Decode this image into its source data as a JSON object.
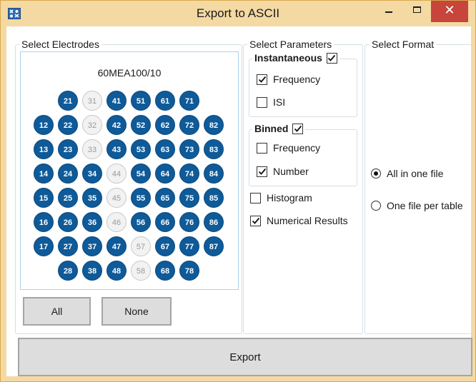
{
  "window": {
    "title": "Export to ASCII",
    "app_icon": "app-logo-icon",
    "minimize_glyph": "–",
    "close_glyph": "✕"
  },
  "electrodes": {
    "group_label": "Select Electrodes",
    "layout_name": "60MEA100/10",
    "grid": [
      [
        {
          "id": "21",
          "on": true
        },
        {
          "id": "31",
          "on": false
        },
        {
          "id": "41",
          "on": true
        },
        {
          "id": "51",
          "on": true
        },
        {
          "id": "61",
          "on": true
        },
        {
          "id": "71",
          "on": true
        }
      ],
      [
        {
          "id": "12",
          "on": true
        },
        {
          "id": "22",
          "on": true
        },
        {
          "id": "32",
          "on": false
        },
        {
          "id": "42",
          "on": true
        },
        {
          "id": "52",
          "on": true
        },
        {
          "id": "62",
          "on": true
        },
        {
          "id": "72",
          "on": true
        },
        {
          "id": "82",
          "on": true
        }
      ],
      [
        {
          "id": "13",
          "on": true
        },
        {
          "id": "23",
          "on": true
        },
        {
          "id": "33",
          "on": false
        },
        {
          "id": "43",
          "on": true
        },
        {
          "id": "53",
          "on": true
        },
        {
          "id": "63",
          "on": true
        },
        {
          "id": "73",
          "on": true
        },
        {
          "id": "83",
          "on": true
        }
      ],
      [
        {
          "id": "14",
          "on": true
        },
        {
          "id": "24",
          "on": true
        },
        {
          "id": "34",
          "on": true
        },
        {
          "id": "44",
          "on": false
        },
        {
          "id": "54",
          "on": true
        },
        {
          "id": "64",
          "on": true
        },
        {
          "id": "74",
          "on": true
        },
        {
          "id": "84",
          "on": true
        }
      ],
      [
        {
          "id": "15",
          "on": true
        },
        {
          "id": "25",
          "on": true
        },
        {
          "id": "35",
          "on": true
        },
        {
          "id": "45",
          "on": false
        },
        {
          "id": "55",
          "on": true
        },
        {
          "id": "65",
          "on": true
        },
        {
          "id": "75",
          "on": true
        },
        {
          "id": "85",
          "on": true
        }
      ],
      [
        {
          "id": "16",
          "on": true
        },
        {
          "id": "26",
          "on": true
        },
        {
          "id": "36",
          "on": true
        },
        {
          "id": "46",
          "on": false
        },
        {
          "id": "56",
          "on": true
        },
        {
          "id": "66",
          "on": true
        },
        {
          "id": "76",
          "on": true
        },
        {
          "id": "86",
          "on": true
        }
      ],
      [
        {
          "id": "17",
          "on": true
        },
        {
          "id": "27",
          "on": true
        },
        {
          "id": "37",
          "on": true
        },
        {
          "id": "47",
          "on": true
        },
        {
          "id": "57",
          "on": false
        },
        {
          "id": "67",
          "on": true
        },
        {
          "id": "77",
          "on": true
        },
        {
          "id": "87",
          "on": true
        }
      ],
      [
        {
          "id": "28",
          "on": true
        },
        {
          "id": "38",
          "on": true
        },
        {
          "id": "48",
          "on": true
        },
        {
          "id": "58",
          "on": false
        },
        {
          "id": "68",
          "on": true
        },
        {
          "id": "78",
          "on": true
        }
      ]
    ],
    "selected_color": "#0f5a98",
    "unselected_color": "#f2f2f2",
    "all_label": "All",
    "none_label": "None"
  },
  "parameters": {
    "group_label": "Select Parameters",
    "instantaneous": {
      "label": "Instantaneous",
      "checked": true,
      "frequency": {
        "label": "Frequency",
        "checked": true
      },
      "isi": {
        "label": "ISI",
        "checked": false
      }
    },
    "binned": {
      "label": "Binned",
      "checked": true,
      "frequency": {
        "label": "Frequency",
        "checked": false
      },
      "number": {
        "label": "Number",
        "checked": true
      }
    },
    "histogram": {
      "label": "Histogram",
      "checked": false
    },
    "numerical_results": {
      "label": "Numerical Results",
      "checked": true
    }
  },
  "format": {
    "group_label": "Select Format",
    "options": [
      {
        "label": "All in one file",
        "selected": true
      },
      {
        "label": "One file per table",
        "selected": false
      }
    ]
  },
  "export_label": "Export"
}
